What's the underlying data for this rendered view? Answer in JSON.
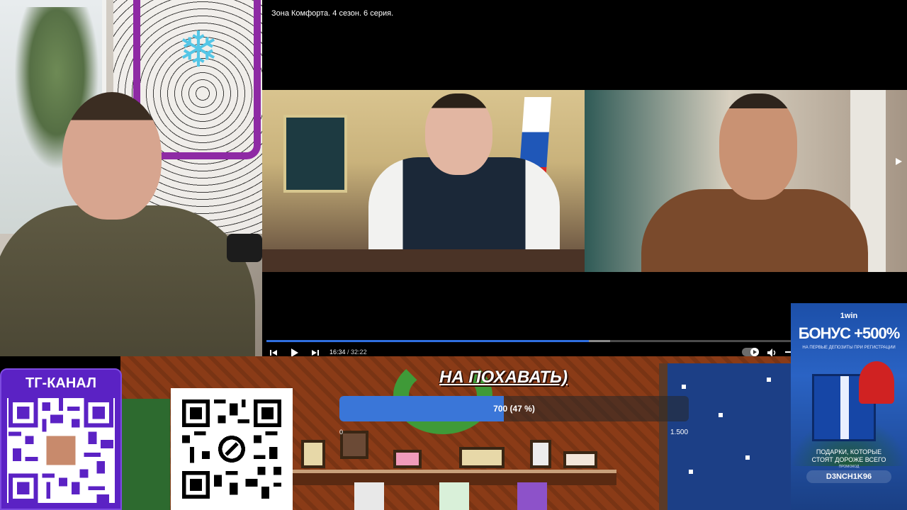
{
  "player": {
    "video_title": "Зона Комфорта. 4 сезон. 6 серия.",
    "progress_fraction": 0.5062,
    "buffer_fraction": 0.54,
    "time_current": "16:34",
    "time_separator": " / ",
    "time_total": "32:22",
    "icons": {
      "prev": "skip-previous-icon",
      "play": "play-icon",
      "next": "skip-next-icon",
      "autoplay": "autoplay-toggle",
      "volume": "volume-icon"
    }
  },
  "game": {
    "donation_title": "НА ПОХАВАТЬ)",
    "donation_progress_text": "700 (47 %)",
    "donation_fraction": 0.47,
    "donation_min": "0",
    "donation_max": "1.500"
  },
  "tg": {
    "title": "ТГ-КАНАЛ"
  },
  "ad": {
    "brand": "1win",
    "bonus": "БОНУС +500%",
    "subtitle": "НА ПЕРВЫЕ ДЕПОЗИТЫ ПРИ РЕГИСТРАЦИИ",
    "gifts_line1": "ПОДАРКИ, КОТОРЫЕ",
    "gifts_line2": "СТОЯТ ДОРОЖЕ ВСЕГО",
    "promo_label": "ПРОМОКОД",
    "promo_code": "D3NCH1K96"
  },
  "colors": {
    "progress": "#2f6fe0",
    "tg_purple": "#5b22c4",
    "game_bg": "#8a3b17"
  }
}
